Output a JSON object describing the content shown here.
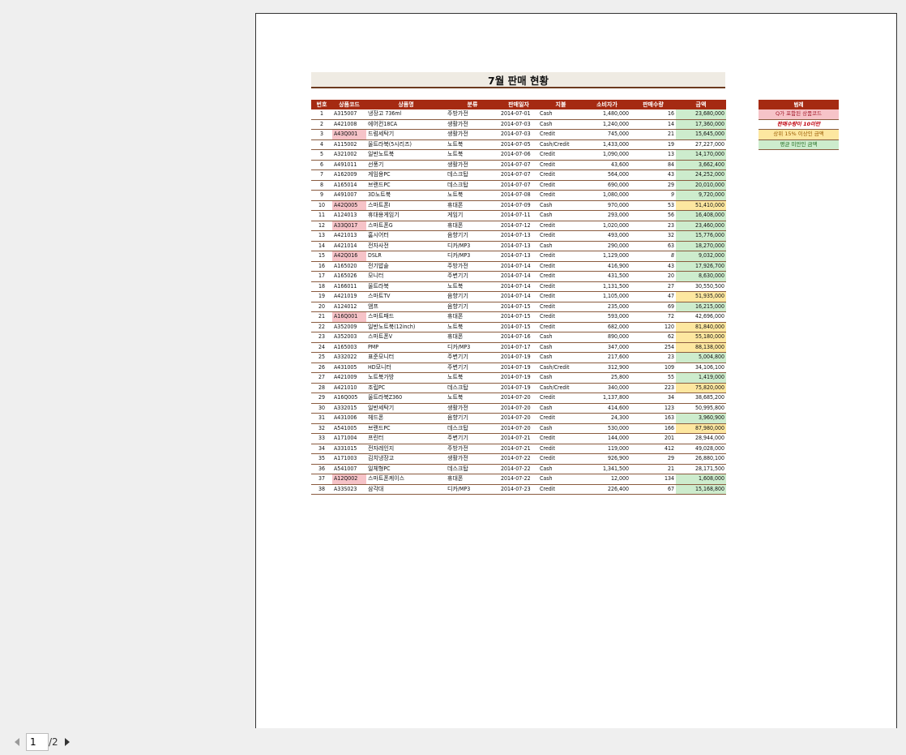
{
  "title": "7월 판매 현황",
  "columns": [
    "번호",
    "상품코드",
    "상품명",
    "분류",
    "판매일자",
    "지불",
    "소비자가",
    "판매수량",
    "금액"
  ],
  "rows": [
    [
      "1",
      "A315007",
      "냉장고 736ml",
      "주방가전",
      "2014-07-01",
      "Cash",
      "1,480,000",
      "16",
      "23,680,000"
    ],
    [
      "2",
      "A421008",
      "에어컨18CA",
      "생활가전",
      "2014-07-03",
      "Cash",
      "1,240,000",
      "14",
      "17,360,000"
    ],
    [
      "3",
      "A43Q001",
      "드럼세탁기",
      "생활가전",
      "2014-07-03",
      "Credit",
      "745,000",
      "21",
      "15,645,000"
    ],
    [
      "4",
      "A115002",
      "울트라북(5시리즈)",
      "노트북",
      "2014-07-05",
      "Cash/Credit",
      "1,433,000",
      "19",
      "27,227,000"
    ],
    [
      "5",
      "A321002",
      "일반노트북",
      "노트북",
      "2014-07-06",
      "Credit",
      "1,090,000",
      "13",
      "14,170,000"
    ],
    [
      "6",
      "A491011",
      "선풍기",
      "생활가전",
      "2014-07-07",
      "Credit",
      "43,600",
      "84",
      "3,662,400"
    ],
    [
      "7",
      "A162009",
      "게임용PC",
      "데스크탑",
      "2014-07-07",
      "Credit",
      "564,000",
      "43",
      "24,252,000"
    ],
    [
      "8",
      "A165014",
      "브랜드PC",
      "데스크탑",
      "2014-07-07",
      "Credit",
      "690,000",
      "29",
      "20,010,000"
    ],
    [
      "9",
      "A491007",
      "3D노트북",
      "노트북",
      "2014-07-08",
      "Credit",
      "1,080,000",
      "9",
      "9,720,000"
    ],
    [
      "10",
      "A42Q005",
      "스마트폰I",
      "휴대폰",
      "2014-07-09",
      "Cash",
      "970,000",
      "53",
      "51,410,000"
    ],
    [
      "11",
      "A124013",
      "휴대용게임기",
      "게임기",
      "2014-07-11",
      "Cash",
      "293,000",
      "56",
      "16,408,000"
    ],
    [
      "12",
      "A33Q017",
      "스마트폰G",
      "휴대폰",
      "2014-07-12",
      "Credit",
      "1,020,000",
      "23",
      "23,460,000"
    ],
    [
      "13",
      "A421013",
      "홈시어터",
      "음향기기",
      "2014-07-13",
      "Credit",
      "493,000",
      "32",
      "15,776,000"
    ],
    [
      "14",
      "A421014",
      "전자사전",
      "디카/MP3",
      "2014-07-13",
      "Cash",
      "290,000",
      "63",
      "18,270,000"
    ],
    [
      "15",
      "A42Q016",
      "DSLR",
      "디카/MP3",
      "2014-07-13",
      "Credit",
      "1,129,000",
      "8",
      "9,032,000"
    ],
    [
      "16",
      "A165020",
      "전기밥솥",
      "주방가전",
      "2014-07-14",
      "Credit",
      "416,900",
      "43",
      "17,926,700"
    ],
    [
      "17",
      "A165026",
      "모니터",
      "주변기기",
      "2014-07-14",
      "Credit",
      "431,500",
      "20",
      "8,630,000"
    ],
    [
      "18",
      "A166011",
      "울트라북",
      "노트북",
      "2014-07-14",
      "Credit",
      "1,131,500",
      "27",
      "30,550,500"
    ],
    [
      "19",
      "A421019",
      "스마트TV",
      "음향기기",
      "2014-07-14",
      "Credit",
      "1,105,000",
      "47",
      "51,935,000"
    ],
    [
      "20",
      "A124012",
      "앰프",
      "음향기기",
      "2014-07-15",
      "Credit",
      "235,000",
      "69",
      "16,215,000"
    ],
    [
      "21",
      "A16Q001",
      "스마트패드",
      "휴대폰",
      "2014-07-15",
      "Credit",
      "593,000",
      "72",
      "42,696,000"
    ],
    [
      "22",
      "A352009",
      "일반노트북(12inch)",
      "노트북",
      "2014-07-15",
      "Credit",
      "682,000",
      "120",
      "81,840,000"
    ],
    [
      "23",
      "A352003",
      "스마트폰V",
      "휴대폰",
      "2014-07-16",
      "Cash",
      "890,000",
      "62",
      "55,180,000"
    ],
    [
      "24",
      "A165003",
      "PMP",
      "디카/MP3",
      "2014-07-17",
      "Cash",
      "347,000",
      "254",
      "88,138,000"
    ],
    [
      "25",
      "A332022",
      "표준모니터",
      "주변기기",
      "2014-07-19",
      "Cash",
      "217,600",
      "23",
      "5,004,800"
    ],
    [
      "26",
      "A431005",
      "HD모니터",
      "주변기기",
      "2014-07-19",
      "Cash/Credit",
      "312,900",
      "109",
      "34,106,100"
    ],
    [
      "27",
      "A421009",
      "노트북가방",
      "노트북",
      "2014-07-19",
      "Cash",
      "25,800",
      "55",
      "1,419,000"
    ],
    [
      "28",
      "A421010",
      "조립PC",
      "데스크탑",
      "2014-07-19",
      "Cash/Credit",
      "340,000",
      "223",
      "75,820,000"
    ],
    [
      "29",
      "A16Q005",
      "울트라북Z360",
      "노트북",
      "2014-07-20",
      "Credit",
      "1,137,800",
      "34",
      "38,685,200"
    ],
    [
      "30",
      "A332015",
      "일반세탁기",
      "생활가전",
      "2014-07-20",
      "Cash",
      "414,600",
      "123",
      "50,995,800"
    ],
    [
      "31",
      "A431006",
      "헤드폰",
      "음향기기",
      "2014-07-20",
      "Credit",
      "24,300",
      "163",
      "3,960,900"
    ],
    [
      "32",
      "A541005",
      "브랜드PC",
      "데스크탑",
      "2014-07-20",
      "Cash",
      "530,000",
      "166",
      "87,980,000"
    ],
    [
      "33",
      "A171004",
      "프린터",
      "주변기기",
      "2014-07-21",
      "Credit",
      "144,000",
      "201",
      "28,944,000"
    ],
    [
      "34",
      "A331015",
      "전자레인지",
      "주방가전",
      "2014-07-21",
      "Credit",
      "119,000",
      "412",
      "49,028,000"
    ],
    [
      "35",
      "A171003",
      "김치냉장고",
      "생활가전",
      "2014-07-22",
      "Credit",
      "926,900",
      "29",
      "26,880,100"
    ],
    [
      "36",
      "A541007",
      "일체형PC",
      "데스크탑",
      "2014-07-22",
      "Cash",
      "1,341,500",
      "21",
      "28,171,500"
    ],
    [
      "37",
      "A12Q002",
      "스마트폰케이스",
      "휴대폰",
      "2014-07-22",
      "Cash",
      "12,000",
      "134",
      "1,608,000"
    ],
    [
      "38",
      "A33S023",
      "삼각대",
      "디카/MP3",
      "2014-07-23",
      "Credit",
      "226,400",
      "67",
      "15,168,800"
    ]
  ],
  "code_highlight_rows": [
    3,
    10,
    12,
    15,
    21,
    37
  ],
  "qty_low_rows": [
    9,
    15
  ],
  "amt_high_rows": [
    10,
    19,
    22,
    23,
    24,
    28,
    32
  ],
  "amt_low_rows": [
    1,
    2,
    3,
    5,
    6,
    7,
    8,
    9,
    11,
    12,
    13,
    14,
    15,
    16,
    17,
    20,
    25,
    27,
    31,
    37,
    38
  ],
  "legend": {
    "title": "범례",
    "items": [
      "Q가 포함된 상품코드",
      "판매수량이 10미만",
      "상위 15% 이상인 금액",
      "평균 미만인 금액"
    ]
  },
  "pager": {
    "current": "1",
    "total": "/2"
  },
  "colors": {
    "header_bg": "#a52a12",
    "code_highlight": "#f6c3c8",
    "amt_high": "#fde7a0",
    "amt_low": "#cdeccd"
  }
}
